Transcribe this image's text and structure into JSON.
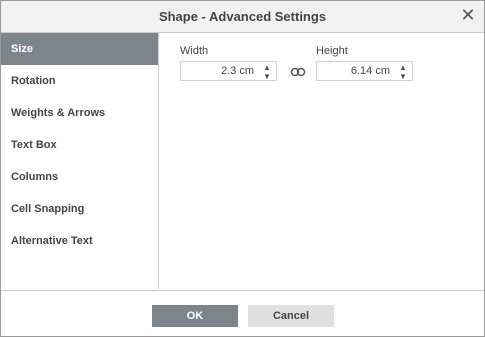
{
  "dialog": {
    "title": "Shape - Advanced Settings",
    "close_icon": "close-icon"
  },
  "sidebar": {
    "items": [
      {
        "label": "Size",
        "active": true
      },
      {
        "label": "Rotation",
        "active": false
      },
      {
        "label": "Weights & Arrows",
        "active": false
      },
      {
        "label": "Text Box",
        "active": false
      },
      {
        "label": "Columns",
        "active": false
      },
      {
        "label": "Cell Snapping",
        "active": false
      },
      {
        "label": "Alternative Text",
        "active": false
      }
    ]
  },
  "size": {
    "width_label": "Width",
    "width_value": "2.3 cm",
    "height_label": "Height",
    "height_value": "6.14 cm",
    "constrain_icon": "link-icon"
  },
  "footer": {
    "ok_label": "OK",
    "cancel_label": "Cancel"
  },
  "colors": {
    "accent": "#7d858c",
    "titlebar": "#f1f1f1",
    "border": "#cbcbcb"
  }
}
